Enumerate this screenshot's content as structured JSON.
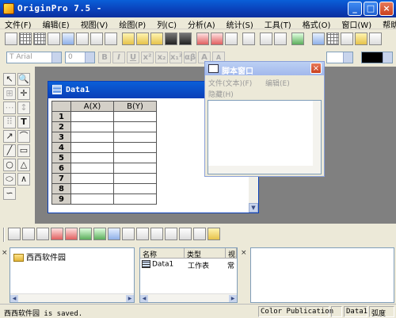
{
  "window": {
    "title": "OriginPro 7.5 -",
    "minimize": "_",
    "maximize": "□",
    "close": "×"
  },
  "menu": [
    "文件(F)",
    "编辑(E)",
    "视图(V)",
    "绘图(P)",
    "列(C)",
    "分析(A)",
    "统计(S)",
    "工具(T)",
    "格式(O)",
    "窗口(W)",
    "帮助(H)"
  ],
  "format_toolbar": {
    "font_name": "T Arial",
    "font_size": "0",
    "bold": "B",
    "italic": "I",
    "underline": "U",
    "superscript": "x²",
    "subscript": "x₂",
    "supersub": "x₁²",
    "greek": "αβ",
    "font_up": "A",
    "font_down": "A"
  },
  "left_tools": [
    "↖",
    "🔍",
    "⊞",
    "✛",
    "⋯",
    "↕",
    "⠿",
    "T",
    "↗",
    "⌒",
    "╱",
    "▭",
    "○",
    "△",
    "⬭",
    "∧",
    "∽"
  ],
  "data_window": {
    "title": "Data1",
    "columns": [
      "A(X)",
      "B(Y)"
    ],
    "rows": [
      "1",
      "2",
      "3",
      "4",
      "5",
      "6",
      "7",
      "8",
      "9"
    ]
  },
  "script_window": {
    "title": "脚本窗口",
    "close": "×",
    "menu": [
      "文件(文本)(F)",
      "编辑(E)"
    ],
    "menu2": "隐藏(H)"
  },
  "project_explorer": {
    "close1": "×",
    "close2": "×",
    "folder": "西西软件园",
    "columns": [
      "名称",
      "类型",
      "视"
    ],
    "rows": [
      {
        "name": "Data1",
        "type": "工作表",
        "view": "常"
      }
    ]
  },
  "status_bar": {
    "message": "西西软件园 is saved.",
    "field1": "Color Publication",
    "field2": "Data1",
    "field3": "弧度"
  },
  "colors": {
    "titlebar": "#0a3fb8",
    "workspace": "#808080",
    "chrome": "#ece9d8"
  }
}
